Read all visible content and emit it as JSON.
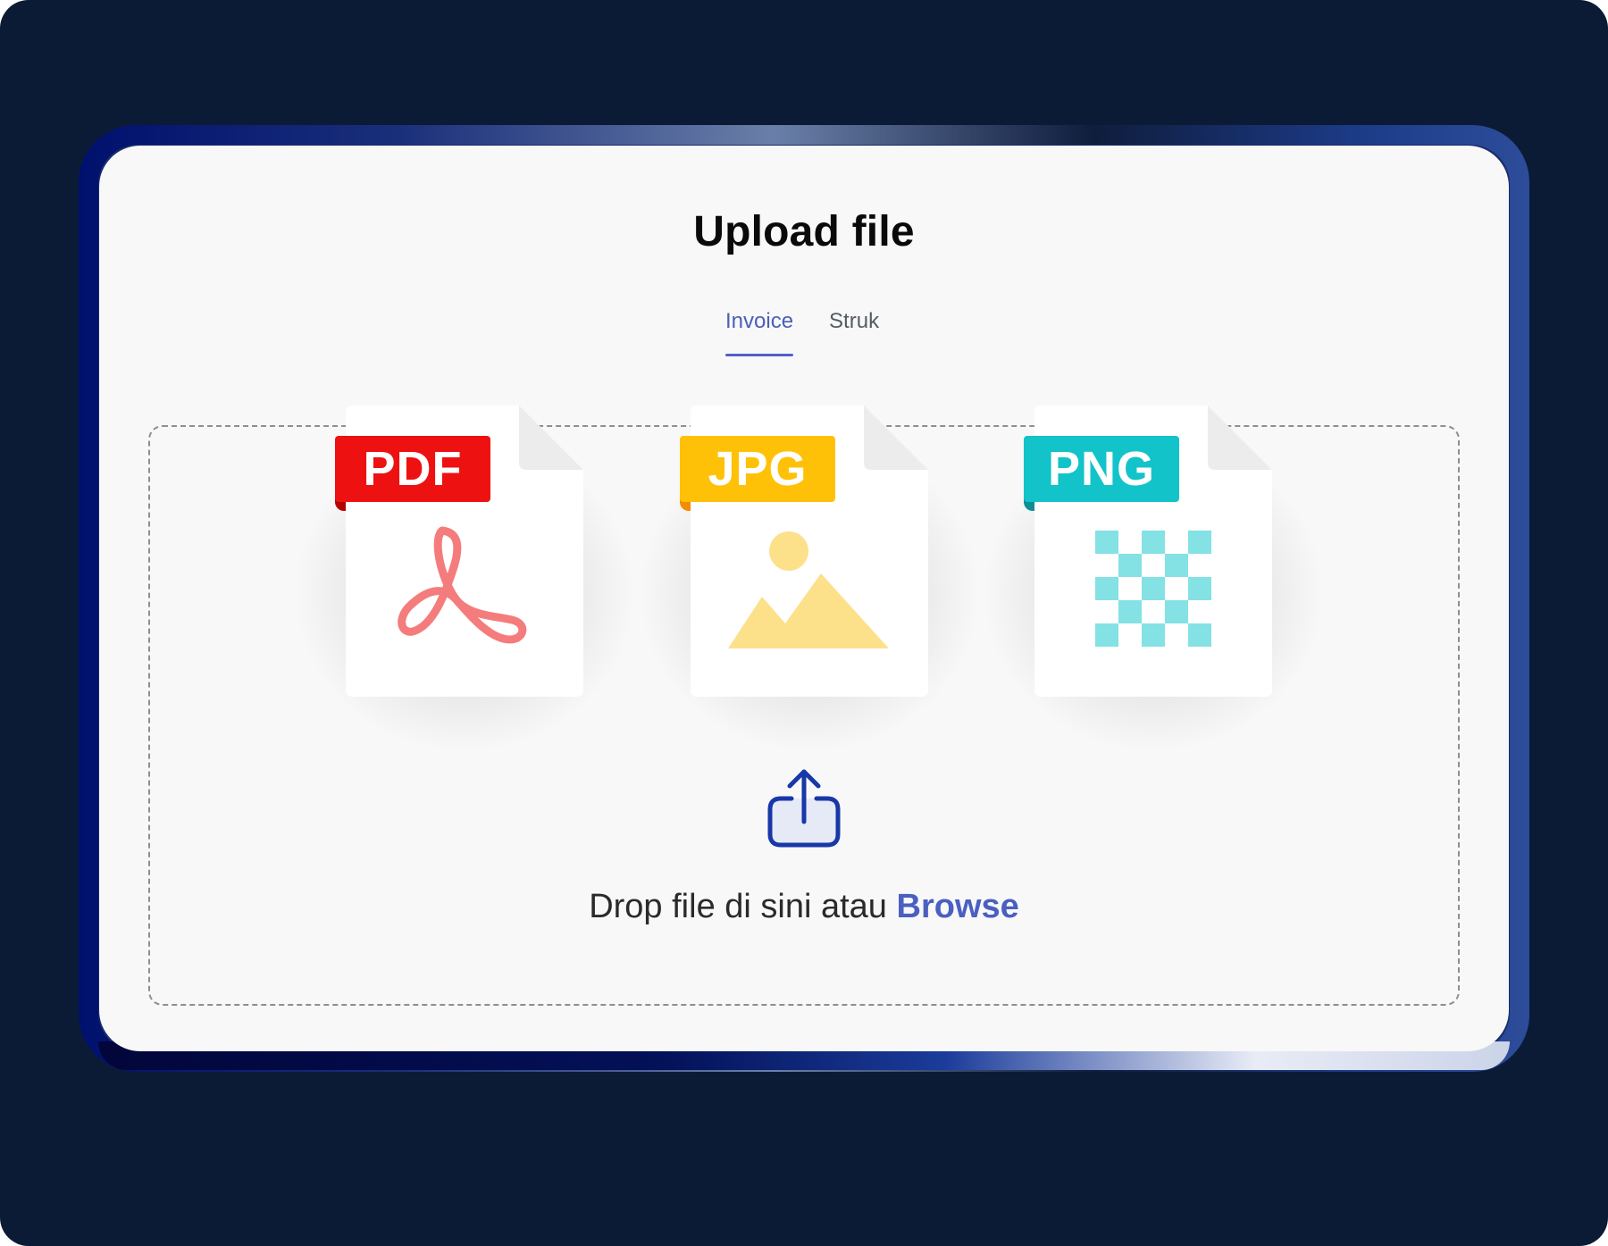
{
  "title": "Upload file",
  "tabs": [
    {
      "label": "Invoice",
      "active": true
    },
    {
      "label": "Struk",
      "active": false
    }
  ],
  "file_types": [
    {
      "label": "PDF",
      "color": "#ee1111",
      "icon": "acrobat-icon",
      "icon_color": "#f47c7c"
    },
    {
      "label": "JPG",
      "color": "#ffc107",
      "icon": "image-icon",
      "icon_color": "#fde08a"
    },
    {
      "label": "PNG",
      "color": "#12c3c9",
      "icon": "checkerboard-icon",
      "icon_color": "#84e1e4"
    }
  ],
  "dropzone": {
    "text": "Drop file di sini atau",
    "browse_label": "Browse",
    "icon": "upload-icon"
  },
  "colors": {
    "accent": "#4a5fc0",
    "background": "#0c1b35",
    "card": "#f8f8f8"
  }
}
